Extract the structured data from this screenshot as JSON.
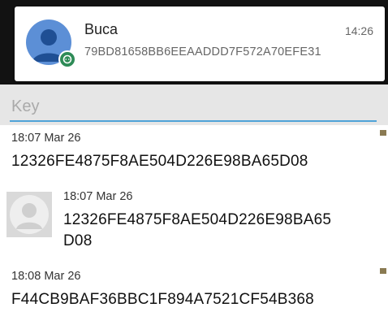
{
  "notification": {
    "sender": "Buca",
    "time": "14:26",
    "body": "79BD81658BB6EEAADDD7F572A70EFE31",
    "avatar_icon": "person-avatar-icon",
    "badge_icon": "chat-badge-icon"
  },
  "search": {
    "placeholder": "Key"
  },
  "messages": [
    {
      "time": "18:07 Mar 26",
      "text": "12326FE4875F8AE504D226E98BA65D08"
    },
    {
      "time": "18:07 Mar 26",
      "text_line1": "12326FE4875F8AE504D226E98BA65",
      "text_line2": "D08",
      "avatar_icon": "contact-avatar-icon"
    },
    {
      "time": "18:08 Mar 26",
      "text": "F44CB9BAF36BBC1F894A7521CF54B368"
    }
  ]
}
